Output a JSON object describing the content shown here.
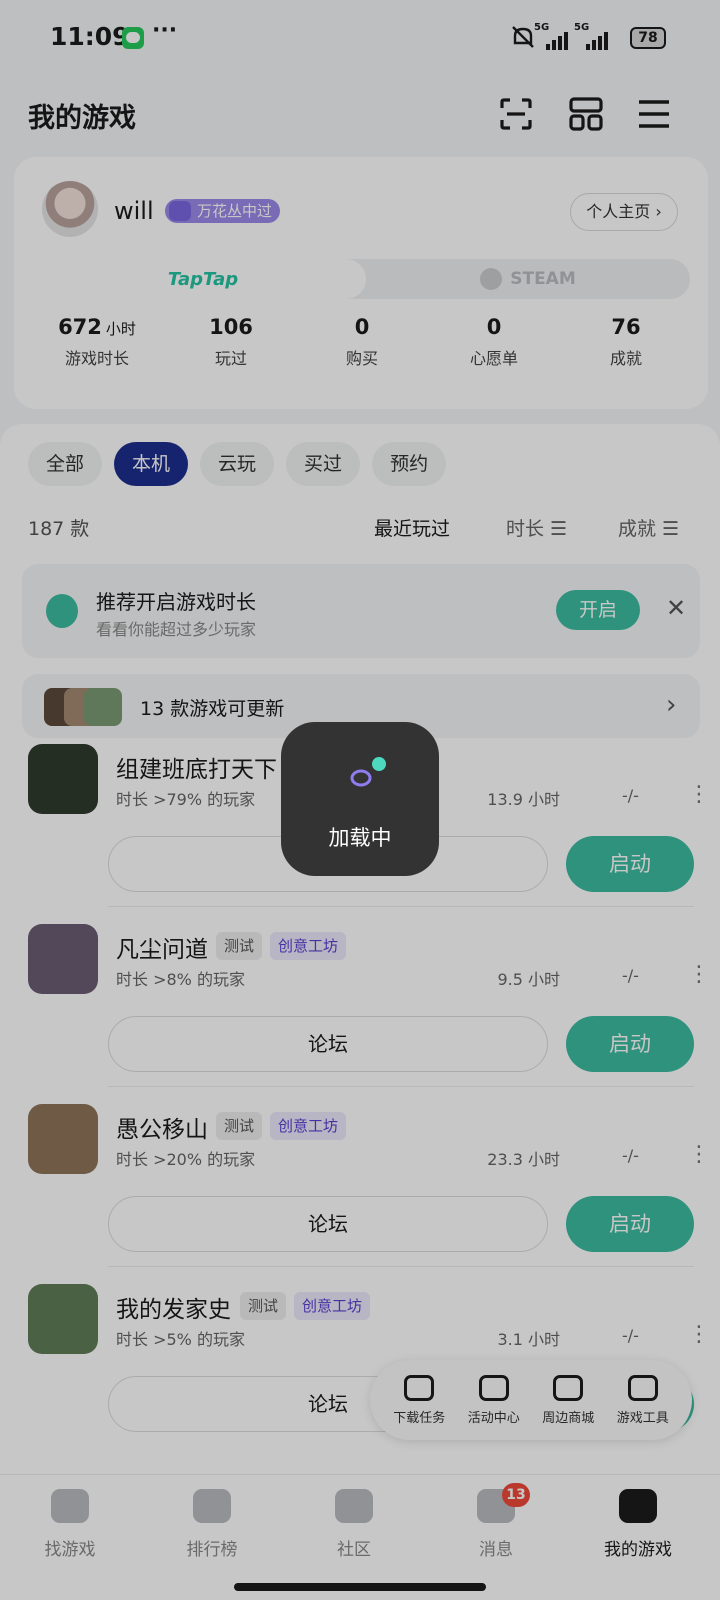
{
  "status_bar": {
    "time": "11:09",
    "more": "···",
    "network_1": "5G",
    "network_2": "5G",
    "battery": "78"
  },
  "header": {
    "title": "我的游戏",
    "icons": [
      "scan-icon",
      "grid-icon",
      "menu-icon"
    ]
  },
  "profile": {
    "username": "will",
    "badge": "万花丛中过",
    "home_button": "个人主页 ›",
    "platforms": [
      "TapTap",
      "STEAM"
    ],
    "stats": [
      {
        "value": "672",
        "unit": "小时",
        "label": "游戏时长"
      },
      {
        "value": "106",
        "unit": "",
        "label": "玩过"
      },
      {
        "value": "0",
        "unit": "",
        "label": "购买"
      },
      {
        "value": "0",
        "unit": "",
        "label": "心愿单"
      },
      {
        "value": "76",
        "unit": "",
        "label": "成就"
      }
    ]
  },
  "filters": {
    "tabs": [
      "全部",
      "本机",
      "云玩",
      "买过",
      "预约"
    ],
    "active_tab": "本机",
    "count": "187 款",
    "sorts": [
      "最近玩过",
      "时长 ☰",
      "成就 ☰"
    ]
  },
  "recommend": {
    "title": "推荐开启游戏时长",
    "subtitle": "看看你能超过多少玩家",
    "button": "开启",
    "close": "✕"
  },
  "updates": {
    "text": "13 款游戏可更新",
    "chevron": "›"
  },
  "games": [
    {
      "name": "组建班底打天下",
      "tags": [],
      "meta": "时长 >79% 的玩家",
      "hours": "13.9 小时",
      "achv": "-/-",
      "forum": "论坛",
      "start": "启动",
      "icon_color": "#2f3b2c"
    },
    {
      "name": "凡尘问道",
      "tags": [
        "测试",
        "创意工坊"
      ],
      "meta": "时长 >8% 的玩家",
      "hours": "9.5 小时",
      "achv": "-/-",
      "forum": "论坛",
      "start": "启动",
      "icon_color": "#6b5d74"
    },
    {
      "name": "愚公移山",
      "tags": [
        "测试",
        "创意工坊"
      ],
      "meta": "时长 >20% 的玩家",
      "hours": "23.3 小时",
      "achv": "-/-",
      "forum": "论坛",
      "start": "启动",
      "icon_color": "#8d7459"
    },
    {
      "name": "我的发家史",
      "tags": [
        "测试",
        "创意工坊"
      ],
      "meta": "时长 >5% 的玩家",
      "hours": "3.1 小时",
      "achv": "-/-",
      "forum": "论坛",
      "start": "启动",
      "icon_color": "#5f7d56"
    }
  ],
  "tools": [
    {
      "label": "下载任务",
      "icon": "download-task-icon"
    },
    {
      "label": "活动中心",
      "icon": "gift-icon"
    },
    {
      "label": "周边商城",
      "icon": "store-icon"
    },
    {
      "label": "游戏工具",
      "icon": "gamepad-icon"
    }
  ],
  "bottom_nav": [
    {
      "label": "找游戏",
      "icon": "taptap-icon"
    },
    {
      "label": "排行榜",
      "icon": "ranking-icon"
    },
    {
      "label": "社区",
      "icon": "community-icon"
    },
    {
      "label": "消息",
      "icon": "message-icon",
      "badge": "13"
    },
    {
      "label": "我的游戏",
      "icon": "my-games-icon",
      "active": true
    }
  ],
  "loading": {
    "text": "加载中"
  },
  "colors": {
    "accent": "#3bbca0",
    "active_tab": "#1d2d8f",
    "badge": "#9b8ae8",
    "workshop": "#5a3fd0",
    "notification": "#ef4a3a"
  }
}
